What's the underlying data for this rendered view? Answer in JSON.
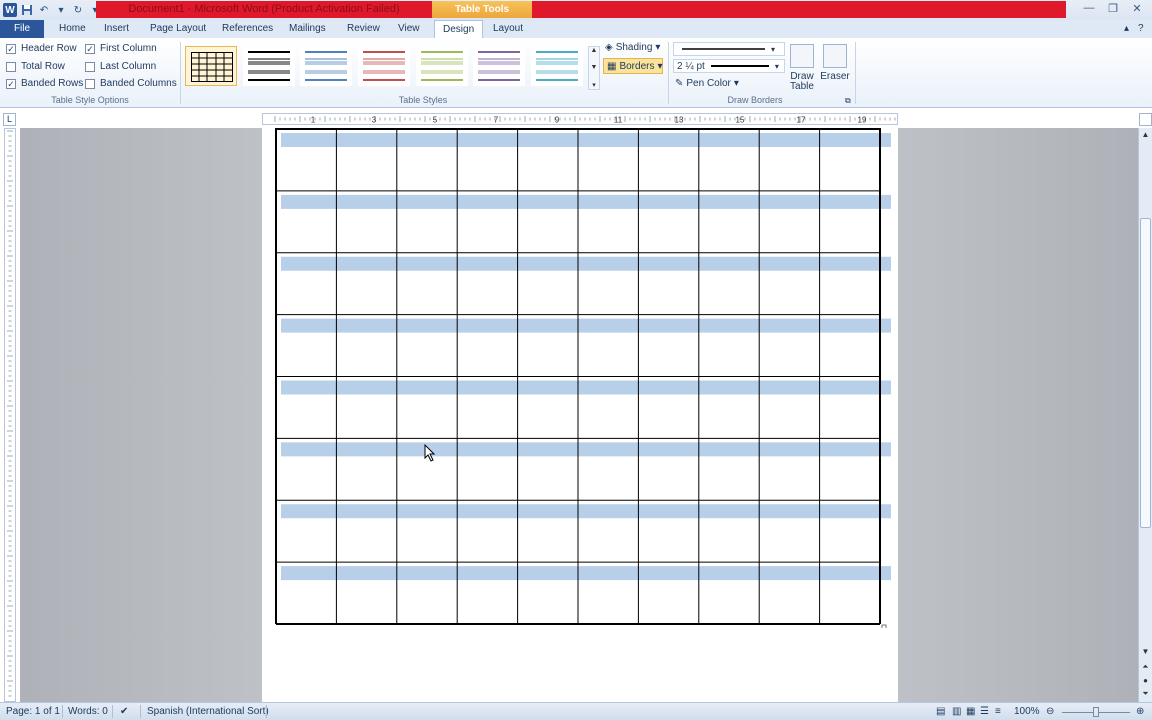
{
  "window": {
    "title": "Document1 - Microsoft Word (Product Activation Failed)",
    "contextual_tab_group": "Table Tools",
    "accent_red": "#e0182b",
    "accent_orange": "#eea53c"
  },
  "tabs": {
    "file": "File",
    "items": [
      "Home",
      "Insert",
      "Page Layout",
      "References",
      "Mailings",
      "Review",
      "View",
      "Design",
      "Layout"
    ],
    "active": "Design"
  },
  "table_style_options": {
    "header_row": "Header Row",
    "first_column": "First Column",
    "total_row": "Total Row",
    "last_column": "Last Column",
    "banded_rows": "Banded Rows",
    "banded_columns": "Banded Columns",
    "label": "Table Style Options",
    "checked": {
      "header_row": true,
      "first_column": true,
      "total_row": false,
      "last_column": false,
      "banded_rows": true,
      "banded_columns": false
    }
  },
  "table_styles": {
    "label": "Table Styles",
    "shading": "Shading",
    "borders": "Borders"
  },
  "draw_borders": {
    "pen_weight": "2 ¼ pt",
    "pen_color": "Pen Color",
    "draw_table": "Draw Table",
    "eraser": "Eraser",
    "label": "Draw Borders"
  },
  "ruler": {
    "numbers": [
      "1",
      "3",
      "5",
      "7",
      "9",
      "11",
      "13",
      "15",
      "17",
      "19"
    ]
  },
  "document": {
    "table": {
      "rows": 8,
      "columns": 10,
      "band_color": "#b8cfe9"
    }
  },
  "status": {
    "page": "Page: 1 of 1",
    "words": "Words: 0",
    "language": "Spanish (International Sort)",
    "zoom": "100%"
  }
}
